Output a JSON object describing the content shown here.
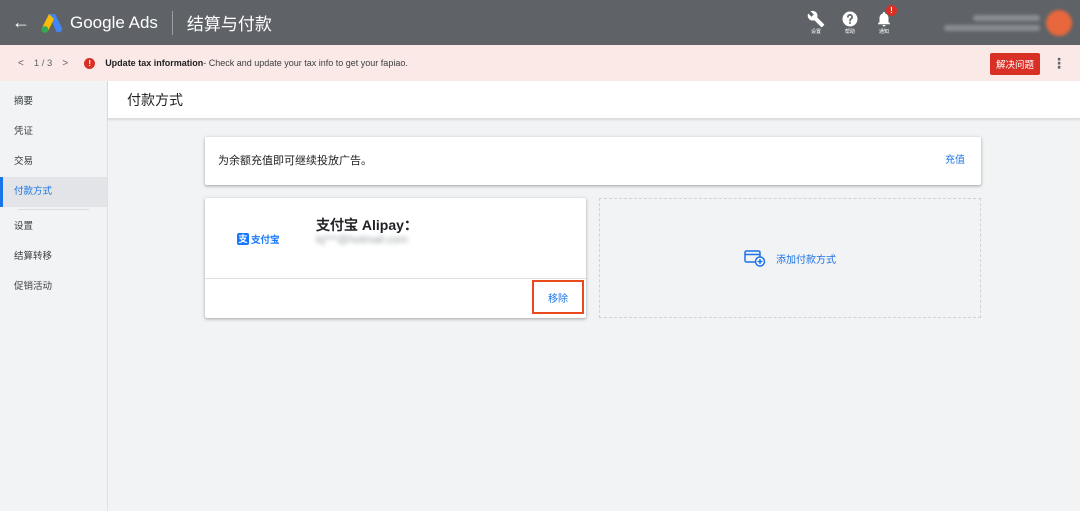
{
  "topbar": {
    "brand": "Google Ads",
    "page_name": "结算与付款",
    "tools": [
      {
        "icon": "wrench-icon",
        "label": "设置"
      },
      {
        "icon": "help-icon",
        "label": "帮助"
      },
      {
        "icon": "bell-icon",
        "label": "通知"
      }
    ],
    "notification_badge": "!"
  },
  "alert": {
    "pager": "1 / 3",
    "icon_text": "!",
    "title": "Update tax information",
    "message": " - Check and update your tax info to get your fapiao.",
    "resolve_label": "解决问题",
    "more_label": "⋮"
  },
  "sidebar": {
    "items": [
      {
        "label": "摘要"
      },
      {
        "label": "凭证"
      },
      {
        "label": "交易"
      },
      {
        "label": "付款方式",
        "active": true
      },
      {
        "label": "设置"
      },
      {
        "label": "结算转移"
      },
      {
        "label": "促销活动"
      }
    ]
  },
  "content": {
    "title": "付款方式"
  },
  "topup_card": {
    "message": "为余额充值即可继续投放广告。",
    "action_label": "充值"
  },
  "alipay_card": {
    "logo_mark": "支",
    "logo_text": "支付宝",
    "name": "支付宝 Alipay：",
    "email": "lq***@hotmail.com",
    "remove_label": "移除"
  },
  "add_method": {
    "label": "添加付款方式"
  },
  "colors": {
    "topbar": "#5f6368",
    "alert_bg": "#fbe9e7",
    "alert_red": "#d93025",
    "link_blue": "#1a73e8",
    "alipay_blue": "#1677ff",
    "highlight_border": "#e8491d"
  }
}
